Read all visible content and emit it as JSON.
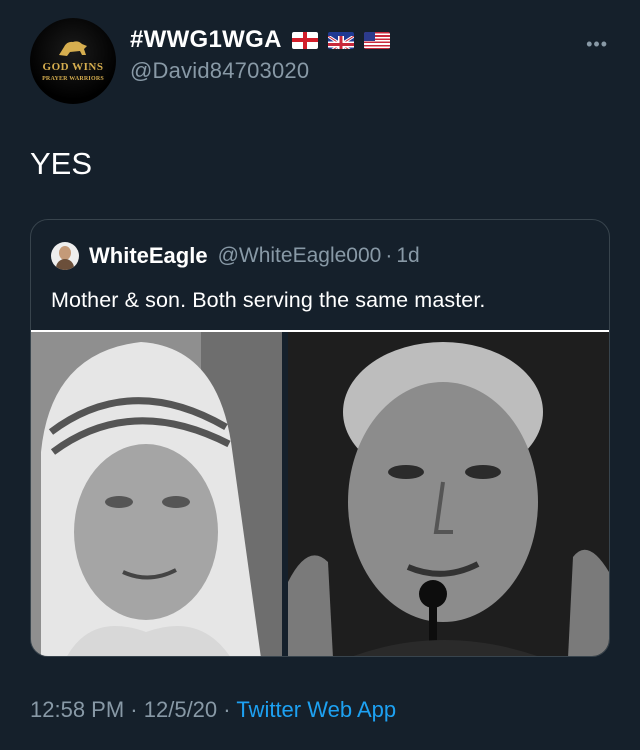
{
  "author": {
    "display_name": "#WWG1WGA",
    "handle": "@David84703020",
    "avatar_line1": "GOD WINS",
    "avatar_line2": "PRAYER WARRIORS",
    "flags": [
      "england-flag-icon",
      "uk-flag-icon",
      "us-flag-icon"
    ]
  },
  "tweet": {
    "text": "YES"
  },
  "quoted_tweet": {
    "name": "WhiteEagle",
    "handle": "@WhiteEagle000",
    "separator": "·",
    "age": "1d",
    "text": "Mother & son. Both serving the same master."
  },
  "footer": {
    "time": "12:58 PM",
    "sep1": "·",
    "date": "12/5/20",
    "sep2": "·",
    "source": "Twitter Web App"
  },
  "colors": {
    "background": "#15202b",
    "secondary_text": "#8899a6",
    "link": "#1da1f2",
    "border": "#38444d",
    "gold": "#d6ae4f"
  }
}
